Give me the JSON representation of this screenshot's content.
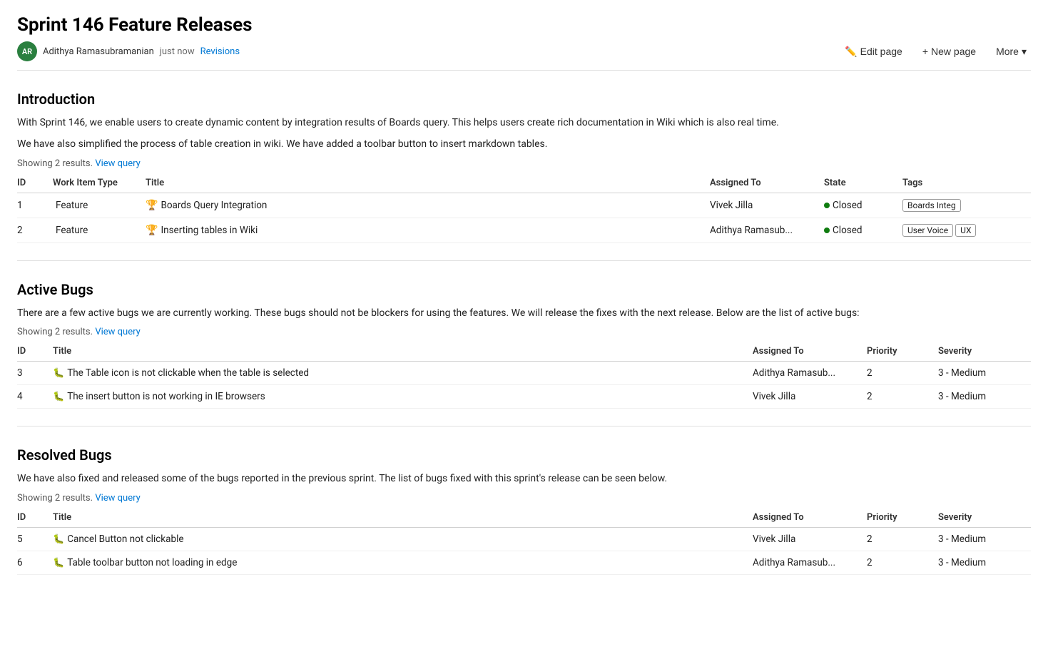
{
  "page": {
    "title": "Sprint 146 Feature Releases"
  },
  "meta": {
    "avatar_initials": "AR",
    "author": "Adithya Ramasubramanian",
    "time": "just now",
    "revisions_label": "Revisions"
  },
  "toolbar": {
    "edit_label": "Edit page",
    "new_label": "New page",
    "more_label": "More"
  },
  "introduction": {
    "heading": "Introduction",
    "para1": "With Sprint 146, we enable users to create dynamic content by integration results of Boards query. This helps users create rich documentation in Wiki which is also real time.",
    "para2": "We have also simplified the process of table creation in wiki. We have added a toolbar button to insert markdown tables.",
    "showing": "Showing 2 results.",
    "view_query": "View query",
    "table": {
      "headers": [
        "ID",
        "Work Item Type",
        "Title",
        "Assigned To",
        "State",
        "Tags"
      ],
      "rows": [
        {
          "id": "1",
          "type": "Feature",
          "type_icon": "🏆",
          "title": "Boards Query Integration",
          "assigned_to": "Vivek Jilla",
          "state": "Closed",
          "tags": [
            "Boards Integ"
          ]
        },
        {
          "id": "2",
          "type": "Feature",
          "type_icon": "🏆",
          "title": "Inserting tables in Wiki",
          "assigned_to": "Adithya Ramasub...",
          "state": "Closed",
          "tags": [
            "User Voice",
            "UX"
          ]
        }
      ]
    }
  },
  "active_bugs": {
    "heading": "Active Bugs",
    "para1": "There are a few active bugs we are currently working. These bugs should not be blockers for using the features. We will release the fixes with the next release. Below are the list of active bugs:",
    "showing": "Showing 2 results.",
    "view_query": "View query",
    "table": {
      "headers": [
        "ID",
        "Title",
        "Assigned To",
        "Priority",
        "Severity"
      ],
      "rows": [
        {
          "id": "3",
          "title": "The Table icon is not clickable when the table is selected",
          "assigned_to": "Adithya Ramasub...",
          "priority": "2",
          "severity": "3 - Medium"
        },
        {
          "id": "4",
          "title": "The insert button is not working in IE browsers",
          "assigned_to": "Vivek Jilla",
          "priority": "2",
          "severity": "3 - Medium"
        }
      ]
    }
  },
  "resolved_bugs": {
    "heading": "Resolved Bugs",
    "para1": "We have also fixed and released some of the bugs reported in the previous sprint. The list of bugs fixed with this sprint's release can be seen below.",
    "showing": "Showing 2 results.",
    "view_query": "View query",
    "table": {
      "headers": [
        "ID",
        "Title",
        "Assigned To",
        "Priority",
        "Severity"
      ],
      "rows": [
        {
          "id": "5",
          "title": "Cancel Button not clickable",
          "assigned_to": "Vivek Jilla",
          "priority": "2",
          "severity": "3 - Medium"
        },
        {
          "id": "6",
          "title": "Table toolbar button not loading in edge",
          "assigned_to": "Adithya Ramasub...",
          "priority": "2",
          "severity": "3 - Medium"
        }
      ]
    }
  }
}
